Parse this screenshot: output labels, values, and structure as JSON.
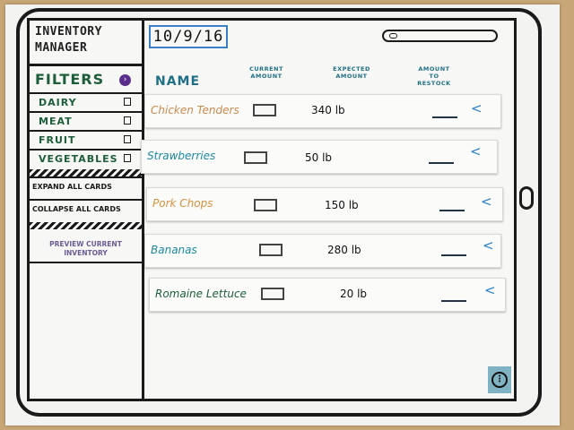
{
  "app": {
    "title": "INVENTORY\nMANAGER",
    "date": "10/9/16"
  },
  "sidebar": {
    "filters_label": "FILTERS",
    "filter_items": [
      {
        "label": "DAIRY"
      },
      {
        "label": "MEAT"
      },
      {
        "label": "FRUIT"
      },
      {
        "label": "VEGETABLES"
      }
    ],
    "expand_label": "EXPAND ALL CARDS",
    "collapse_label": "COLLAPSE ALL CARDS",
    "preview_label": "PREVIEW CURRENT\nINVENTORY"
  },
  "columns": {
    "name": "NAME",
    "current": "CURRENT\nAMOUNT",
    "expected": "EXPECTED\nAMOUNT",
    "restock": "AMOUNT\nTO\nRESTOCK"
  },
  "items": [
    {
      "name": "Chicken Tenders",
      "expected": "340 lb",
      "color": "#c98a4a"
    },
    {
      "name": "Strawberries",
      "expected": "50 lb",
      "color": "#1b8aa0"
    },
    {
      "name": "Pork Chops",
      "expected": "150 lb",
      "color": "#d9903e"
    },
    {
      "name": "Bananas",
      "expected": "280 lb",
      "color": "#1b8aa0"
    },
    {
      "name": "Romaine Lettuce",
      "expected": "20 lb",
      "color": "#1d5e3a"
    }
  ],
  "icons": {
    "filters": "circle-arrow-icon",
    "search": "search-icon",
    "expand_card": "chevron-left-icon",
    "menu": "more-vertical-icon"
  },
  "colors": {
    "accent_blue": "#3b7fc4",
    "filter_green": "#1d5e3a",
    "header_teal": "#1f6f86",
    "preview_purple": "#6b5c93",
    "fab_bg": "#7fb3c4"
  }
}
